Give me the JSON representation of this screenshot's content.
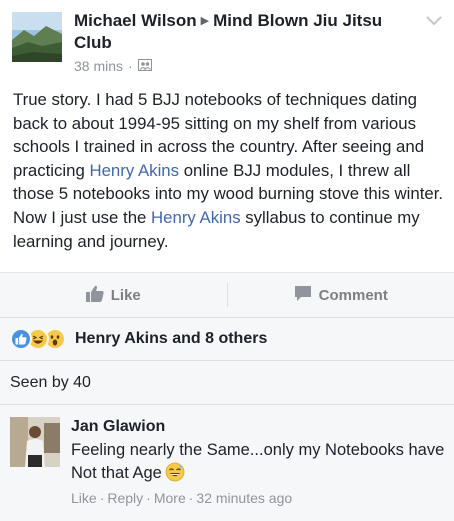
{
  "post": {
    "author": "Michael Wilson",
    "target": "Mind Blown Jiu Jitsu Club",
    "time": "38 mins",
    "privacy_icon": "group-audience-icon",
    "text_parts": [
      "True story. I had 5 BJJ notebooks of techniques dating back to about 1994-95 sitting on my shelf from various schools I trained in across the country. After seeing and practicing ",
      "Henry Akins",
      " online BJJ modules, I threw all those 5 notebooks into my wood burning stove this winter. Now I just use the ",
      "Henry Akins",
      " syllabus to continue my learning and journey."
    ]
  },
  "actions": {
    "like_label": "Like",
    "comment_label": "Comment"
  },
  "reactions": {
    "icons": [
      "like-reaction-icon",
      "haha-reaction-icon",
      "wow-reaction-icon"
    ],
    "summary": "Henry Akins and 8 others"
  },
  "seen": {
    "label": "Seen by 40"
  },
  "comment": {
    "author": "Jan Glawion",
    "text": "Feeling nearly the Same...only my Notebooks have Not that Age",
    "emoji": "sweat-smile-emoji",
    "like_label": "Like",
    "reply_label": "Reply",
    "more_label": "More",
    "time": "32 minutes ago",
    "separator": "·"
  },
  "colors": {
    "link": "#4267b2",
    "muted": "#90949c",
    "panel": "#f6f7f9",
    "like_blue": "#4a90e2",
    "emoji_yellow": "#f7c948"
  }
}
